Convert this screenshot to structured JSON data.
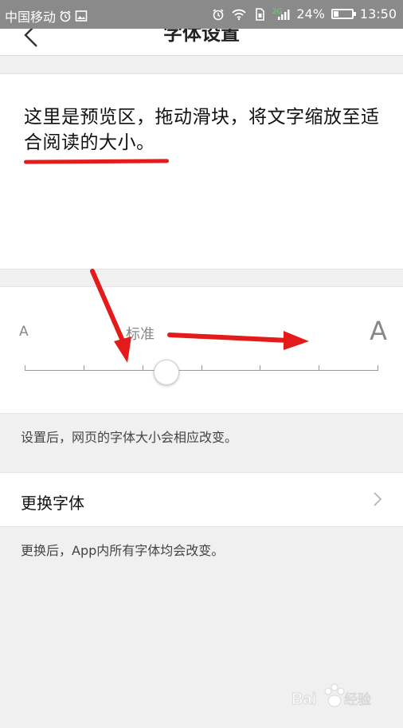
{
  "status_bar": {
    "carrier": "中国移动",
    "network_badge": "2G",
    "battery_percent": "24%",
    "battery_level": 0.24,
    "time": "13:50"
  },
  "header": {
    "title": "字体设置"
  },
  "preview": {
    "text": "这里是预览区，拖动滑块，将文字缩放至适合阅读的大小。"
  },
  "font_slider": {
    "small_label": "A",
    "standard_label": "标准",
    "large_label": "A",
    "steps": 7,
    "current_step": 2
  },
  "hint_font_size": "设置后，网页的字体大小会相应改变。",
  "change_font": {
    "label": "更换字体"
  },
  "hint_change_font": "更换后，App内所有字体均会改变。",
  "colors": {
    "annotation_red": "#e31b1b",
    "status_bar_bg": "#8a8a8a",
    "page_bg": "#f0f0f0"
  }
}
